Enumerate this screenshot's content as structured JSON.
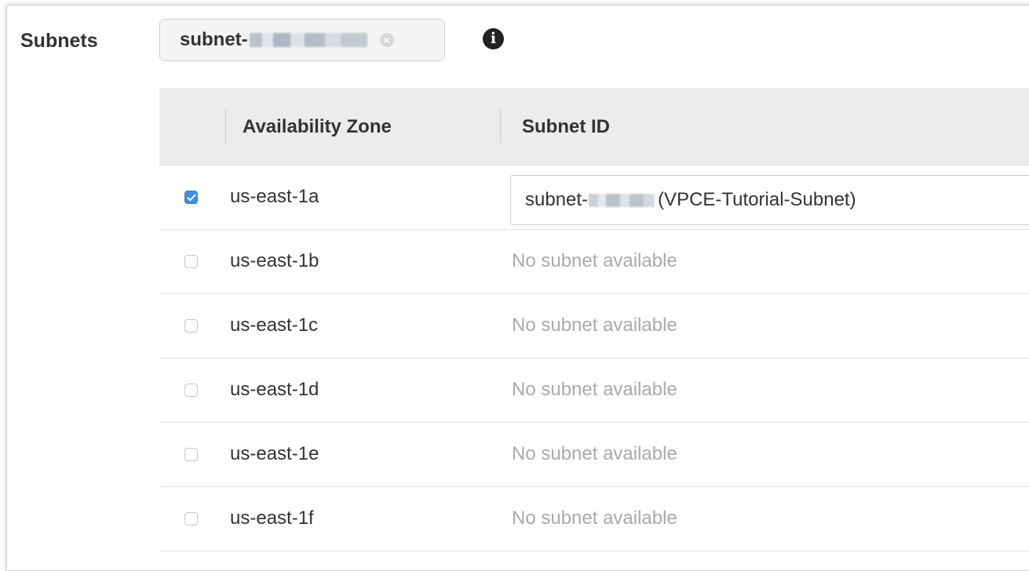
{
  "subnets_label": "Subnets",
  "selected_token": {
    "prefix": "subnet-",
    "remove_glyph": "×"
  },
  "info_icon": {
    "name": "info-icon",
    "glyph": "i"
  },
  "table": {
    "columns": [
      "Availability Zone",
      "Subnet ID"
    ],
    "rows": [
      {
        "zone": "us-east-1a",
        "checked": true,
        "subnet_prefix": "subnet-",
        "subnet_suffix": "(VPCE-Tutorial-Subnet)"
      },
      {
        "zone": "us-east-1b",
        "checked": false,
        "subnet_text": "No subnet available"
      },
      {
        "zone": "us-east-1c",
        "checked": false,
        "subnet_text": "No subnet available"
      },
      {
        "zone": "us-east-1d",
        "checked": false,
        "subnet_text": "No subnet available"
      },
      {
        "zone": "us-east-1e",
        "checked": false,
        "subnet_text": "No subnet available"
      },
      {
        "zone": "us-east-1f",
        "checked": false,
        "subnet_text": "No subnet available"
      }
    ]
  },
  "colors": {
    "checkbox_checked": "#3a8eed",
    "header_bg": "#ececec",
    "muted_text": "#aaaaaa"
  }
}
